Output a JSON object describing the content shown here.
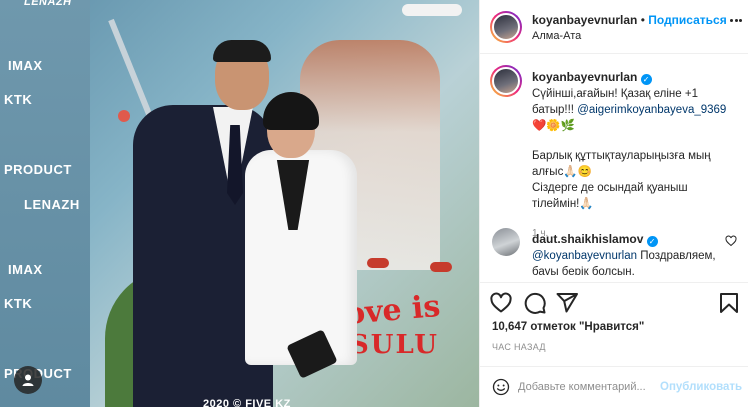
{
  "photo": {
    "sponsors": [
      "LENAZH",
      "IMAX",
      "KTK",
      "PRODUCT",
      "LENAZH",
      "IMAX",
      "KTK",
      "PRODUCT"
    ],
    "poster_title_line1": "ove is",
    "poster_title_line2": "SULU",
    "copyright": "2020 © FIVE KZ"
  },
  "header": {
    "username": "koyanbayevnurlan",
    "separator": "•",
    "follow_label": "Подписаться",
    "location": "Алма-Ата"
  },
  "caption": {
    "username": "koyanbayevnurlan",
    "text1": " Сүйінші,ағайын! Қазақ еліне +1 батыр!!!",
    "mention": "@aigerimkoyanbayeva_9369",
    "text2": " ❤️🌼🌿",
    "text3": "Барлық құттықтауларыңызға мың алғыс🙏🏻😊",
    "text4": "Сіздерге де осындай қуаныш тілеймін!🙏🏻",
    "age": "1 ч."
  },
  "comment": {
    "username": "daut.shaikhislamov",
    "mention": "@koyanbayevnurlan",
    "text": " Поздравляем, бауы берік болсын."
  },
  "actions": {
    "likes": "10,647 отметок \"Нравится\"",
    "timestamp": "ЧАС НАЗАД"
  },
  "add_comment": {
    "placeholder": "Добавьте комментарий...",
    "post_label": "Опубликовать"
  },
  "colors": {
    "accent": "#0095f6",
    "mention": "#00376b",
    "muted": "#8e8e8e",
    "border": "#efefef"
  }
}
